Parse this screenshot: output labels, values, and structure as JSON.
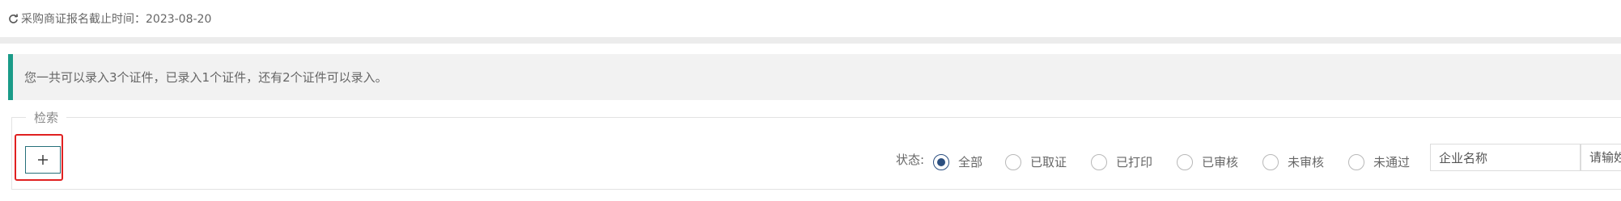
{
  "deadline": {
    "icon": "refresh-icon",
    "text": "采购商证报名截止时间：2023-08-20"
  },
  "notice": {
    "text": "您一共可以录入3个证件，已录入1个证件，还有2个证件可以录入。",
    "accent_color": "#1a9b88"
  },
  "search": {
    "legend": "检索",
    "add_button": {
      "icon": "plus-icon",
      "highlight_color": "#e02020"
    },
    "status_label": "状态:",
    "status_options": [
      {
        "label": "全部",
        "selected": true
      },
      {
        "label": "已取证",
        "selected": false
      },
      {
        "label": "已打印",
        "selected": false
      },
      {
        "label": "已审核",
        "selected": false
      },
      {
        "label": "未审核",
        "selected": false
      },
      {
        "label": "未通过",
        "selected": false
      }
    ],
    "company_field": {
      "value": "企业名称"
    },
    "second_field": {
      "placeholder": "请输姓"
    }
  }
}
